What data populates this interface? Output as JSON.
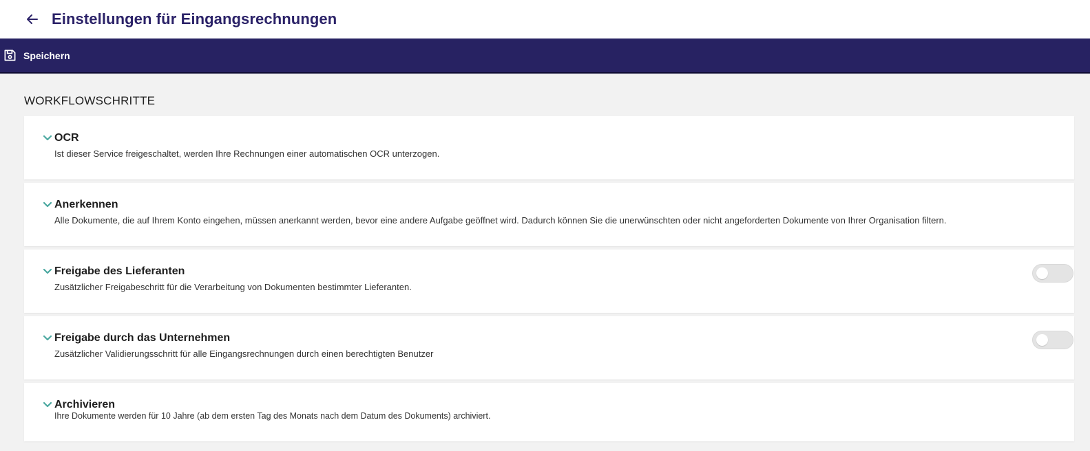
{
  "header": {
    "title": "Einstellungen für Eingangsrechnungen",
    "back_icon": "arrow-left-icon"
  },
  "toolbar": {
    "save_label": "Speichern",
    "save_icon": "floppy-disk-icon"
  },
  "section": {
    "title": "WORKFLOWSCHRITTE"
  },
  "steps": [
    {
      "title": "OCR",
      "description": "Ist dieser Service freigeschaltet, werden Ihre Rechnungen einer automatischen OCR unterzogen.",
      "has_toggle": false
    },
    {
      "title": "Anerkennen",
      "description": "Alle Dokumente, die auf Ihrem Konto eingehen, müssen anerkannt werden, bevor eine andere Aufgabe geöffnet wird. Dadurch können Sie die unerwünschten oder nicht angeforderten Dokumente von Ihrer Organisation filtern.",
      "has_toggle": false
    },
    {
      "title": "Freigabe des Lieferanten",
      "description": "Zusätzlicher Freigabeschritt für die Verarbeitung von Dokumenten bestimmter Lieferanten.",
      "has_toggle": true,
      "toggle_on": false
    },
    {
      "title": "Freigabe durch das Unternehmen",
      "description": "Zusätzlicher Validierungsschritt für alle Eingangsrechnungen durch einen berechtigten Benutzer",
      "has_toggle": true,
      "toggle_on": false
    },
    {
      "title": "Archivieren",
      "description": "Ihre Dokumente werden für 10 Jahre (ab dem ersten Tag des Monats nach dem Datum des Dokuments) archiviert.",
      "has_toggle": false
    }
  ],
  "colors": {
    "brand": "#272262",
    "title": "#2b2268",
    "chevron": "#4ba8a0",
    "background": "#f2f2f2"
  }
}
